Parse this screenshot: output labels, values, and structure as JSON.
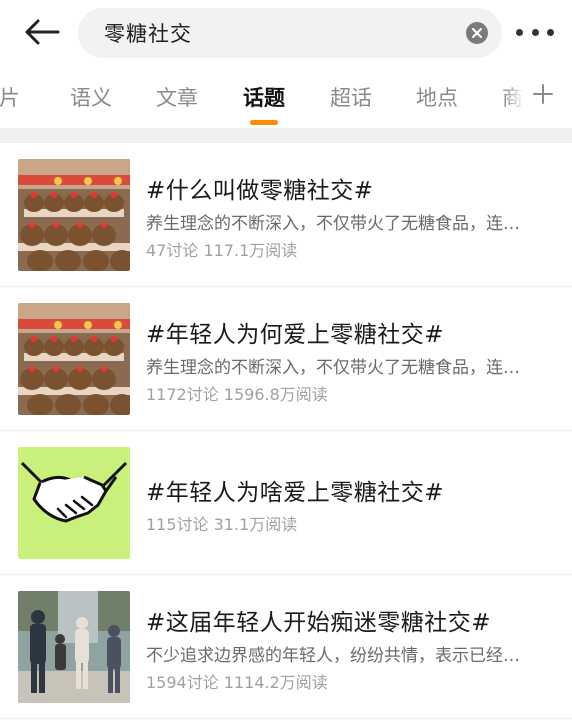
{
  "search": {
    "query": "零糖社交"
  },
  "icons": {
    "back": "back-arrow-icon",
    "clear": "clear-icon",
    "more": "more-icon",
    "add": "plus-icon"
  },
  "colors": {
    "accent": "#ff8a00"
  },
  "tabs": [
    {
      "label": "图片"
    },
    {
      "label": "语义"
    },
    {
      "label": "文章"
    },
    {
      "label": "话题",
      "active": true
    },
    {
      "label": "超话"
    },
    {
      "label": "地点"
    },
    {
      "label": "商"
    }
  ],
  "topics": [
    {
      "title": "#什么叫做零糖社交#",
      "desc": "养生理念的不断深入，不仅带火了无糖食品，连…",
      "meta": "47讨论 117.1万阅读",
      "thumb": "plush-toys-photo"
    },
    {
      "title": "#年轻人为何爱上零糖社交#",
      "desc": "养生理念的不断深入，不仅带火了无糖食品，连…",
      "meta": "1172讨论 1596.8万阅读",
      "thumb": "plush-toys-photo"
    },
    {
      "title": "#年轻人为啥爱上零糖社交#",
      "desc": "",
      "meta": "115讨论 31.1万阅读",
      "thumb": "handshake-illustration"
    },
    {
      "title": "#这届年轻人开始痴迷零糖社交#",
      "desc": "不少追求边界感的年轻人，纷纷共情，表示已经…",
      "meta": "1594讨论 1114.2万阅读",
      "thumb": "people-photo"
    }
  ]
}
